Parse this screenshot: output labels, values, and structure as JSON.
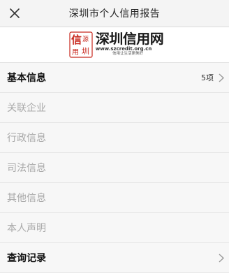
{
  "header": {
    "title": "深圳市个人信用报告",
    "close_icon": "close-icon"
  },
  "banner": {
    "logo_name": "深圳信用网",
    "logo_url": "www.szcredit.org.cn",
    "logo_slogan": "信用让生活更美好",
    "seal_chars": [
      "信",
      "源",
      "用",
      "圳"
    ],
    "seal_color": "#c8281e"
  },
  "sections": [
    {
      "label": "基本信息",
      "count": "5项",
      "active": true,
      "icon": "chevron-right-icon"
    },
    {
      "label": "关联企业",
      "count": "",
      "active": false,
      "icon": ""
    },
    {
      "label": "行政信息",
      "count": "",
      "active": false,
      "icon": ""
    },
    {
      "label": "司法信息",
      "count": "",
      "active": false,
      "icon": ""
    },
    {
      "label": "其他信息",
      "count": "",
      "active": false,
      "icon": ""
    },
    {
      "label": "本人声明",
      "count": "",
      "active": false,
      "icon": ""
    },
    {
      "label": "查询记录",
      "count": "",
      "active": true,
      "icon": "chevron-right-icon"
    }
  ],
  "colors": {
    "active_text": "#111111",
    "disabled_text": "#a9a9a9",
    "chevron": "#999999"
  }
}
